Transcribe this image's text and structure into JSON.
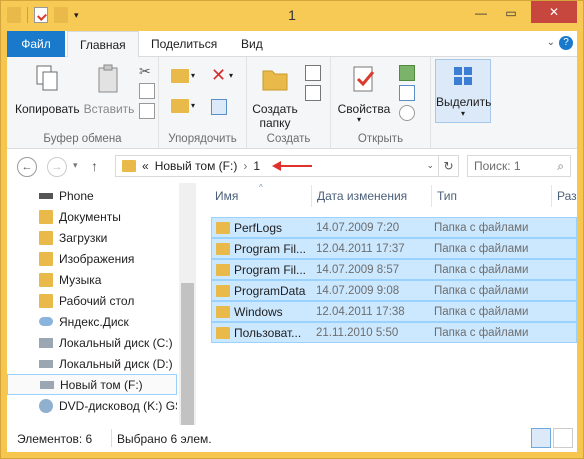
{
  "window": {
    "title": "1"
  },
  "qat": {
    "icons": [
      "folder-icon",
      "properties-icon",
      "new-folder-icon",
      "dropdown-icon"
    ]
  },
  "window_controls": {
    "minimize": "—",
    "maximize": "▭",
    "close": "✕"
  },
  "ribbon": {
    "tabs": [
      "Файл",
      "Главная",
      "Поделиться",
      "Вид"
    ],
    "groups": {
      "clipboard": {
        "label": "Буфер обмена",
        "copy": "Копировать",
        "paste": "Вставить"
      },
      "organize": {
        "label": "Упорядочить"
      },
      "new": {
        "label": "Создать",
        "new_folder": "Создать папку"
      },
      "open": {
        "label": "Открыть",
        "properties": "Свойства"
      },
      "select": {
        "label": "Выделить"
      }
    }
  },
  "address": {
    "prefix": "«",
    "crumb1": "Новый том (F:)",
    "separator": "›",
    "crumb2": "1",
    "search_placeholder": "Поиск: 1",
    "arrow_color": "#e0312d"
  },
  "nav": {
    "items": [
      {
        "label": "Phone",
        "icon": "phone-icon"
      },
      {
        "label": "Документы",
        "icon": "folder-icon"
      },
      {
        "label": "Загрузки",
        "icon": "folder-icon"
      },
      {
        "label": "Изображения",
        "icon": "folder-icon"
      },
      {
        "label": "Музыка",
        "icon": "folder-icon"
      },
      {
        "label": "Рабочий стол",
        "icon": "folder-icon"
      },
      {
        "label": "Яндекс.Диск",
        "icon": "cloud-icon"
      },
      {
        "label": "Локальный диск (C:)",
        "icon": "drive-icon"
      },
      {
        "label": "Локальный диск (D:)",
        "icon": "drive-icon"
      },
      {
        "label": "Новый том (F:)",
        "icon": "drive-icon"
      },
      {
        "label": "DVD-дисковод (K:) GS",
        "icon": "dvd-icon"
      }
    ]
  },
  "list": {
    "columns": [
      "Имя",
      "Дата изменения",
      "Тип",
      "Раз"
    ],
    "rows": [
      {
        "name": "PerfLogs",
        "date": "14.07.2009 7:20",
        "type": "Папка с файлами"
      },
      {
        "name": "Program Fil...",
        "date": "12.04.2011 17:37",
        "type": "Папка с файлами"
      },
      {
        "name": "Program Fil...",
        "date": "14.07.2009 8:57",
        "type": "Папка с файлами"
      },
      {
        "name": "ProgramData",
        "date": "14.07.2009 9:08",
        "type": "Папка с файлами"
      },
      {
        "name": "Windows",
        "date": "12.04.2011 17:38",
        "type": "Папка с файлами"
      },
      {
        "name": "Пользоват...",
        "date": "21.11.2010 5:50",
        "type": "Папка с файлами"
      }
    ]
  },
  "status": {
    "count": "Элементов: 6",
    "selected": "Выбрано 6 элем."
  }
}
